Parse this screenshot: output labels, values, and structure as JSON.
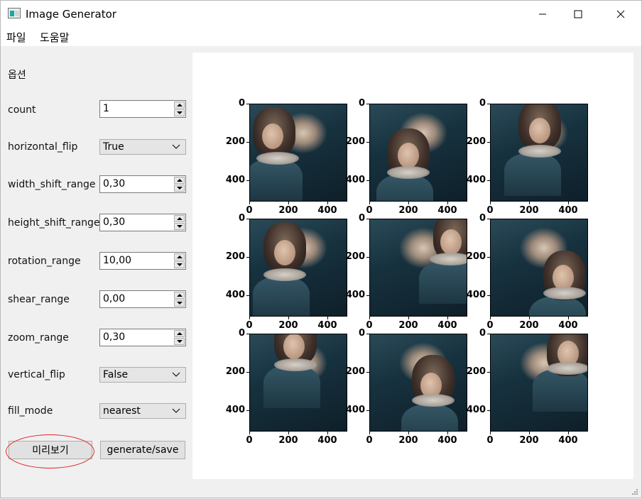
{
  "window": {
    "title": "Image Generator",
    "minimize": "minimize",
    "maximize": "maximize",
    "close": "close"
  },
  "menu": [
    "파일",
    "도움말"
  ],
  "options": {
    "header": "옵션",
    "rows": [
      {
        "label": "count",
        "type": "spin",
        "value": "1"
      },
      {
        "label": "horizontal_flip",
        "type": "combo",
        "value": "True"
      },
      {
        "label": "width_shift_range",
        "type": "spin",
        "value": "0,30"
      },
      {
        "label": "height_shift_range",
        "type": "spin",
        "value": "0,30"
      },
      {
        "label": "rotation_range",
        "type": "spin",
        "value": "10,00"
      },
      {
        "label": "shear_range",
        "type": "spin",
        "value": "0,00"
      },
      {
        "label": "zoom_range",
        "type": "spin",
        "value": "0,30"
      },
      {
        "label": "vertical_flip",
        "type": "combo",
        "value": "False"
      },
      {
        "label": "fill_mode",
        "type": "combo",
        "value": "nearest"
      }
    ],
    "preview_button": "미리보기",
    "generate_button": "generate/save"
  },
  "preview": {
    "yticks": [
      "0",
      "200",
      "400"
    ],
    "xticks": [
      "0",
      "200",
      "400"
    ],
    "grid_rows": 3,
    "grid_cols": 3
  },
  "colors": {
    "annotation": "#e0262b",
    "panel": "#ffffff",
    "window_bg": "#f0f0f0"
  }
}
